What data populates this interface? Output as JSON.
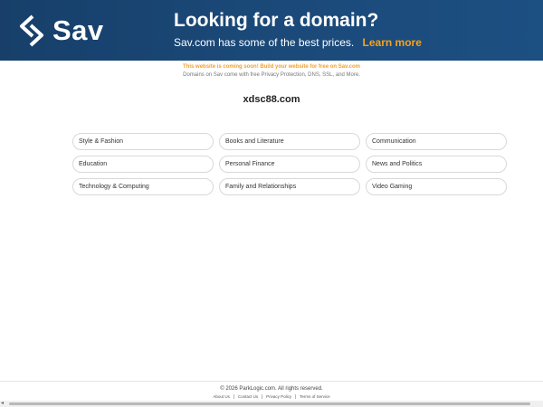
{
  "banner": {
    "logo_text": "Sav",
    "headline": "Looking for a domain?",
    "subline": "Sav.com has some of the best prices.",
    "learn_more": "Learn more",
    "background_color": "#1b4a7a",
    "accent_color": "#f7a21b"
  },
  "notice": {
    "line1": "This website is coming soon! Build your website for free on Sav.com",
    "line2": "Domains on Sav come with free Privacy Protection, DNS, SSL, and More."
  },
  "domain_name": "xdsc88.com",
  "categories": [
    "Style & Fashion",
    "Books and Literature",
    "Communication",
    "Education",
    "Personal Finance",
    "News and Politics",
    "Technology & Computing",
    "Family and Relationships",
    "Video Gaming"
  ],
  "footer": {
    "copyright": "© 2026 ParkLogic.com. All rights reserved.",
    "links": [
      "About Us",
      "Contact Us",
      "Privacy Policy",
      "Terms of Service"
    ]
  }
}
